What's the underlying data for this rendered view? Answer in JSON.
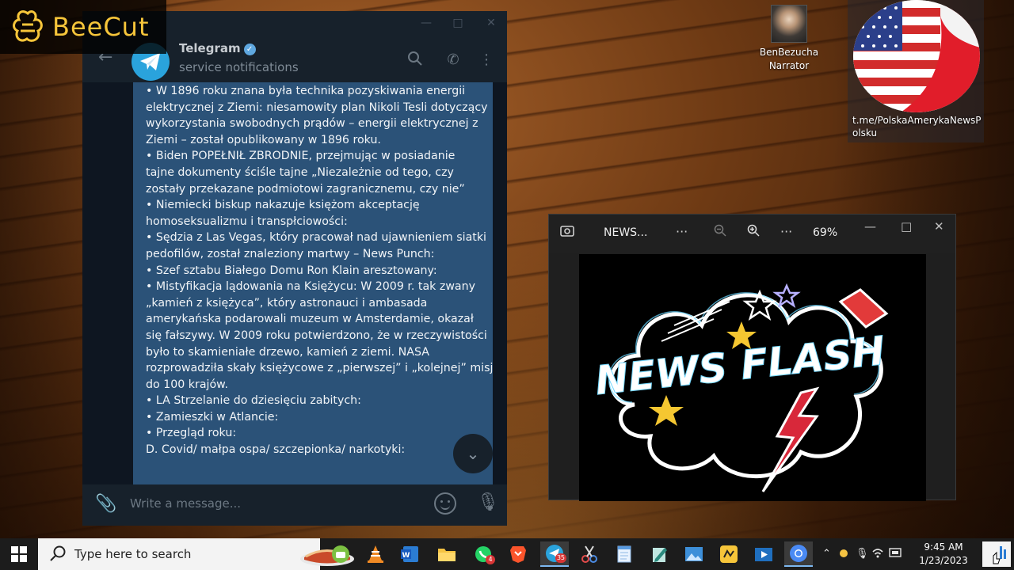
{
  "watermark": {
    "brand": "BeeCut"
  },
  "telegram": {
    "window_title": "Telegram",
    "chat_name": "Telegram",
    "chat_status": "service notifications",
    "message_lines": [
      "•   W 1896 roku znana była technika pozyskiwania energii",
      "elektrycznej z Ziemi: niesamowity plan Nikoli Tesli dotyczący",
      "wykorzystania swobodnych prądów – energii elektrycznej z",
      "Ziemi – został opublikowany w 1896 roku.",
      "•   Biden POPEŁNIŁ ZBRODNIE, przejmując w posiadanie",
      "tajne dokumenty ściśle tajne „Niezależnie od tego, czy",
      "zostały przekazane podmiotowi zagranicznemu, czy nie”",
      " ",
      "•   Niemiecki biskup nakazuje księżom akceptację",
      "homoseksualizmu i transpłciowości:",
      "•   Sędzia z Las Vegas, który pracował nad ujawnieniem siatki",
      "pedofilów, został znaleziony martwy – News Punch:",
      "•   Szef sztabu Białego Domu Ron Klain aresztowany:",
      "•   Mistyfikacja lądowania na Księżycu: W 2009 r. tak zwany",
      "„kamień z księżyca”, który astronauci i ambasada",
      "amerykańska podarowali muzeum w Amsterdamie, okazał",
      "się fałszywy. W 2009 roku potwierdzono, że w rzeczywistości",
      "było to skamieniałe drzewo, kamień z ziemi. NASA",
      "rozprowadziła skały księżycowe z „pierwszej” i „kolejnej” misji",
      "do 100 krajów.",
      "•   LA Strzelanie do dziesięciu zabitych:",
      "•   Zamieszki w Atlancie:",
      "•   Przegląd roku:",
      " ",
      "D. Covid/ małpa ospa/ szczepionka/ narkotyki:"
    ],
    "input_placeholder": "Write a message..."
  },
  "desktop": {
    "icon_narrator": {
      "line1": "BenBezucha",
      "line2": "Narrator"
    },
    "icon_channel": {
      "label": "t.me/PolskaAmerykaNewsPolsku"
    }
  },
  "viewer": {
    "file_name": "NEWS...",
    "zoom": "69%",
    "image_text": "NEWS FLASH"
  },
  "taskbar": {
    "search_placeholder": "Type here to search",
    "whatsapp_badge": "4",
    "telegram_badge": "35",
    "time": "9:45 AM",
    "date": "1/23/2023"
  }
}
